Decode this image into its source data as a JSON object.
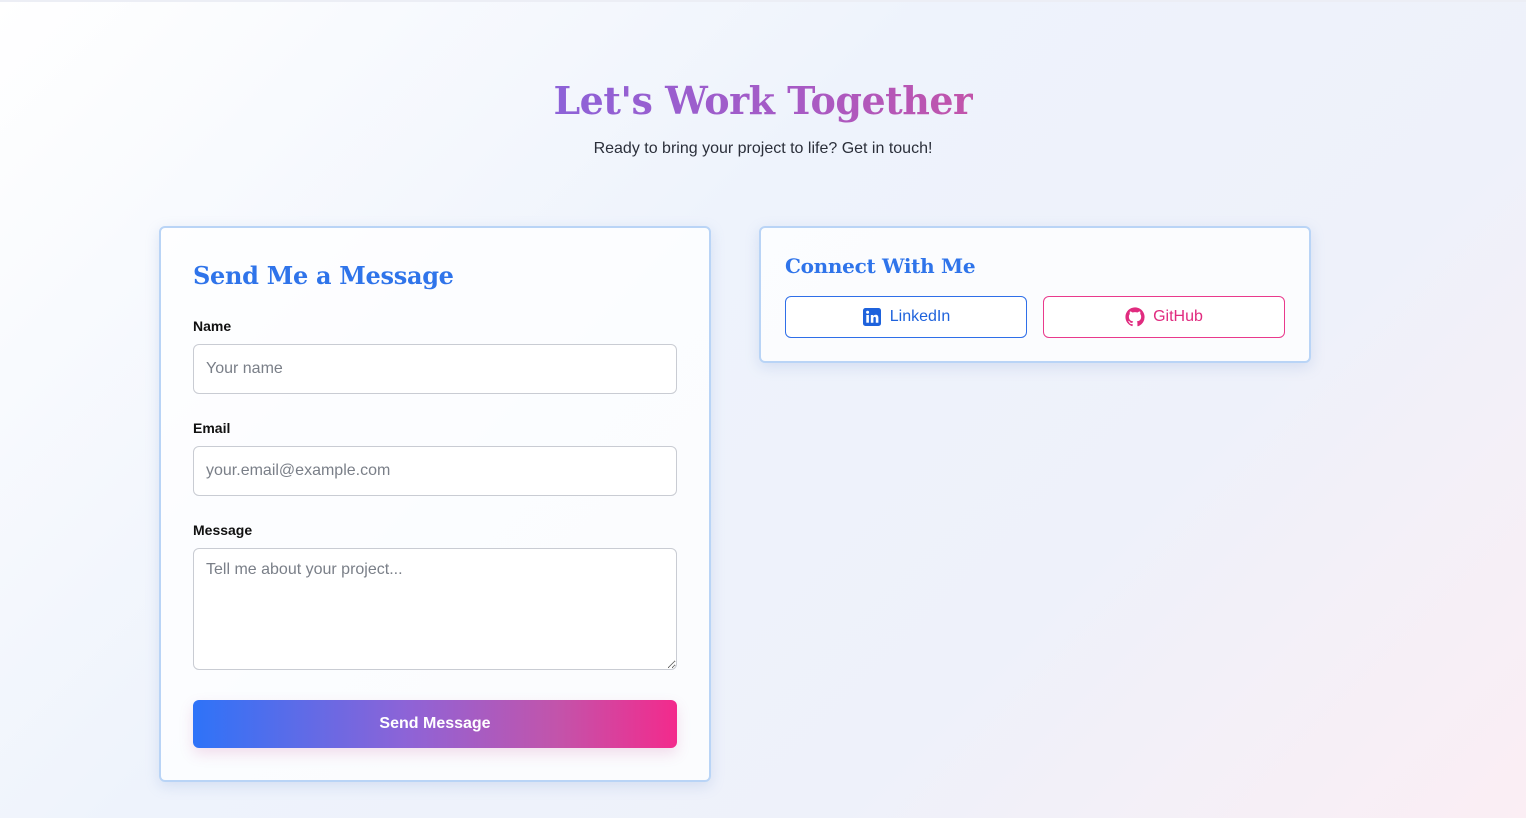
{
  "hero": {
    "title": "Let's Work Together",
    "subtitle": "Ready to bring your project to life? Get in touch!"
  },
  "form": {
    "title": "Send Me a Message",
    "name_label": "Name",
    "name_placeholder": "Your name",
    "email_label": "Email",
    "email_placeholder": "your.email@example.com",
    "message_label": "Message",
    "message_placeholder": "Tell me about your project...",
    "submit_label": "Send Message"
  },
  "connect": {
    "title": "Connect With Me",
    "linkedin_label": "LinkedIn",
    "linkedin_icon": "linkedin-icon",
    "github_label": "GitHub",
    "github_icon": "github-icon"
  },
  "colors": {
    "accent_blue": "#2f74ea",
    "accent_pink": "#e02b7f",
    "title_purple": "#a85ac4"
  }
}
